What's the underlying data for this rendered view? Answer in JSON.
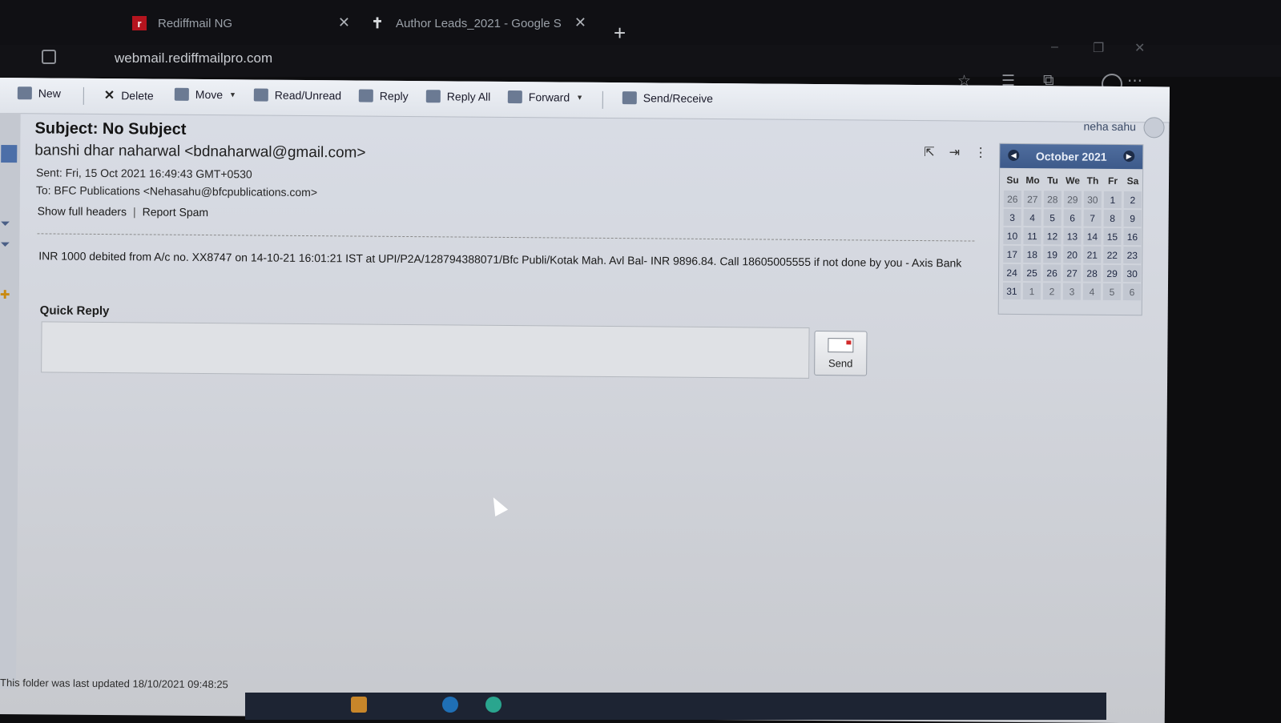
{
  "browser": {
    "tabs": [
      {
        "title": "Rediffmail NG",
        "favicon": "rediff-r-icon"
      },
      {
        "title": "Author Leads_2021 - Google S",
        "favicon": "sheets-icon"
      }
    ],
    "address": "webmail.rediffmailpro.com"
  },
  "toolbar": {
    "new": "New",
    "delete": "Delete",
    "move": "Move",
    "read_unread": "Read/Unread",
    "reply": "Reply",
    "reply_all": "Reply All",
    "forward": "Forward",
    "send_receive": "Send/Receive"
  },
  "user": {
    "name": "neha sahu"
  },
  "mail": {
    "subject": "Subject: No Subject",
    "from": "banshi dhar naharwal <bdnaharwal@gmail.com>",
    "sent": "Sent: Fri, 15 Oct 2021 16:49:43 GMT+0530",
    "to": "To: BFC Publications <Nehasahu@bfcpublications.com>",
    "show_headers": "Show full headers",
    "report_spam": "Report Spam",
    "body": "INR 1000 debited from A/c no. XX8747 on 14-10-21 16:01:21 IST at UPI/P2A/128794388071/Bfc Publi/Kotak Mah. Avl Bal- INR 9896.84. Call 18605005555 if not done by you - Axis Bank"
  },
  "quick_reply": {
    "title": "Quick Reply",
    "send_label": "Send"
  },
  "calendar": {
    "title": "October 2021",
    "day_names": [
      "Su",
      "Mo",
      "Tu",
      "We",
      "Th",
      "Fr",
      "Sa"
    ],
    "weeks": [
      [
        "26",
        "27",
        "28",
        "29",
        "30",
        "1",
        "2"
      ],
      [
        "3",
        "4",
        "5",
        "6",
        "7",
        "8",
        "9"
      ],
      [
        "10",
        "11",
        "12",
        "13",
        "14",
        "15",
        "16"
      ],
      [
        "17",
        "18",
        "19",
        "20",
        "21",
        "22",
        "23"
      ],
      [
        "24",
        "25",
        "26",
        "27",
        "28",
        "29",
        "30"
      ],
      [
        "31",
        "1",
        "2",
        "3",
        "4",
        "5",
        "6"
      ]
    ]
  },
  "status_text": "This folder was last updated 18/10/2021 09:48:25",
  "colors": {
    "calendar_header": "#3d5a8a",
    "toolbar_bg": "#dfe3ea",
    "page_bg": "#d3d6dd"
  }
}
